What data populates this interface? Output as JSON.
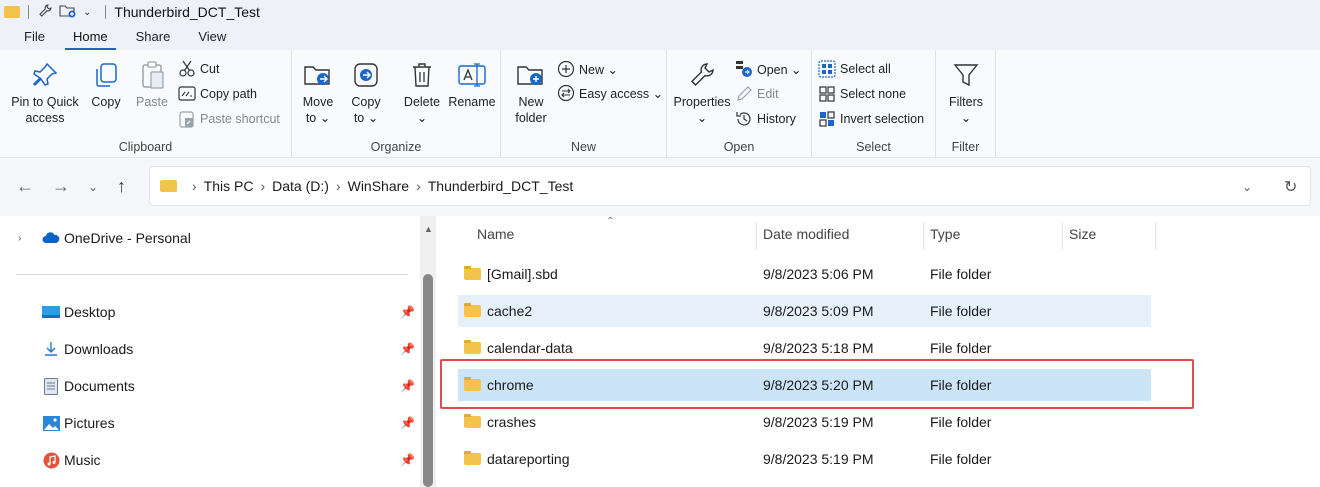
{
  "window": {
    "title": "Thunderbird_DCT_Test"
  },
  "menu_tabs": [
    "File",
    "Home",
    "Share",
    "View"
  ],
  "active_tab": "Home",
  "ribbon": {
    "clipboard": {
      "label": "Clipboard",
      "pin_line1": "Pin to Quick",
      "pin_line2": "access",
      "copy": "Copy",
      "paste": "Paste",
      "cut": "Cut",
      "copy_path": "Copy path",
      "paste_shortcut": "Paste shortcut"
    },
    "organize": {
      "label": "Organize",
      "move_line1": "Move",
      "move_line2": "to ⌄",
      "copy_line1": "Copy",
      "copy_line2": "to ⌄",
      "delete_line1": "Delete",
      "delete_line2": "⌄",
      "rename": "Rename"
    },
    "new": {
      "label": "New",
      "new_folder_line1": "New",
      "new_folder_line2": "folder",
      "new_item": "New ⌄",
      "easy_access": "Easy access ⌄"
    },
    "open": {
      "label": "Open",
      "properties_line1": "Properties",
      "properties_line2": "⌄",
      "open": "Open ⌄",
      "edit": "Edit",
      "history": "History"
    },
    "select": {
      "label": "Select",
      "select_all": "Select all",
      "select_none": "Select none",
      "invert_selection": "Invert selection"
    },
    "filter": {
      "label": "Filter",
      "filters_line1": "Filters",
      "filters_line2": "⌄"
    }
  },
  "address": {
    "breadcrumbs": [
      "This PC",
      "Data (D:)",
      "WinShare",
      "Thunderbird_DCT_Test"
    ]
  },
  "nav_pane": {
    "onedrive": "OneDrive - Personal",
    "quick_access": [
      {
        "label": "Desktop",
        "icon": "desktop-icon",
        "color": "#2b9fe6"
      },
      {
        "label": "Downloads",
        "icon": "downloads-icon",
        "color": "#1f7ad1"
      },
      {
        "label": "Documents",
        "icon": "documents-icon",
        "color": "#6b7a8f"
      },
      {
        "label": "Pictures",
        "icon": "pictures-icon",
        "color": "#2a86d8"
      },
      {
        "label": "Music",
        "icon": "music-icon",
        "color": "#e0553a"
      }
    ]
  },
  "file_list": {
    "columns": [
      "Name",
      "Date modified",
      "Type",
      "Size"
    ],
    "rows": [
      {
        "name": "[Gmail].sbd",
        "date": "9/8/2023 5:06 PM",
        "type": "File folder",
        "state": "normal"
      },
      {
        "name": "cache2",
        "date": "9/8/2023 5:09 PM",
        "type": "File folder",
        "state": "hover"
      },
      {
        "name": "calendar-data",
        "date": "9/8/2023 5:18 PM",
        "type": "File folder",
        "state": "normal"
      },
      {
        "name": "chrome",
        "date": "9/8/2023 5:20 PM",
        "type": "File folder",
        "state": "selected"
      },
      {
        "name": "crashes",
        "date": "9/8/2023 5:19 PM",
        "type": "File folder",
        "state": "normal"
      },
      {
        "name": "datareporting",
        "date": "9/8/2023 5:19 PM",
        "type": "File folder",
        "state": "normal"
      }
    ]
  },
  "colors": {
    "accent": "#1a67c9",
    "selection": "#cce4f7",
    "hover": "#e5f0fb",
    "highlight_box": "#e04b4b",
    "folder": "#f3c44b"
  }
}
